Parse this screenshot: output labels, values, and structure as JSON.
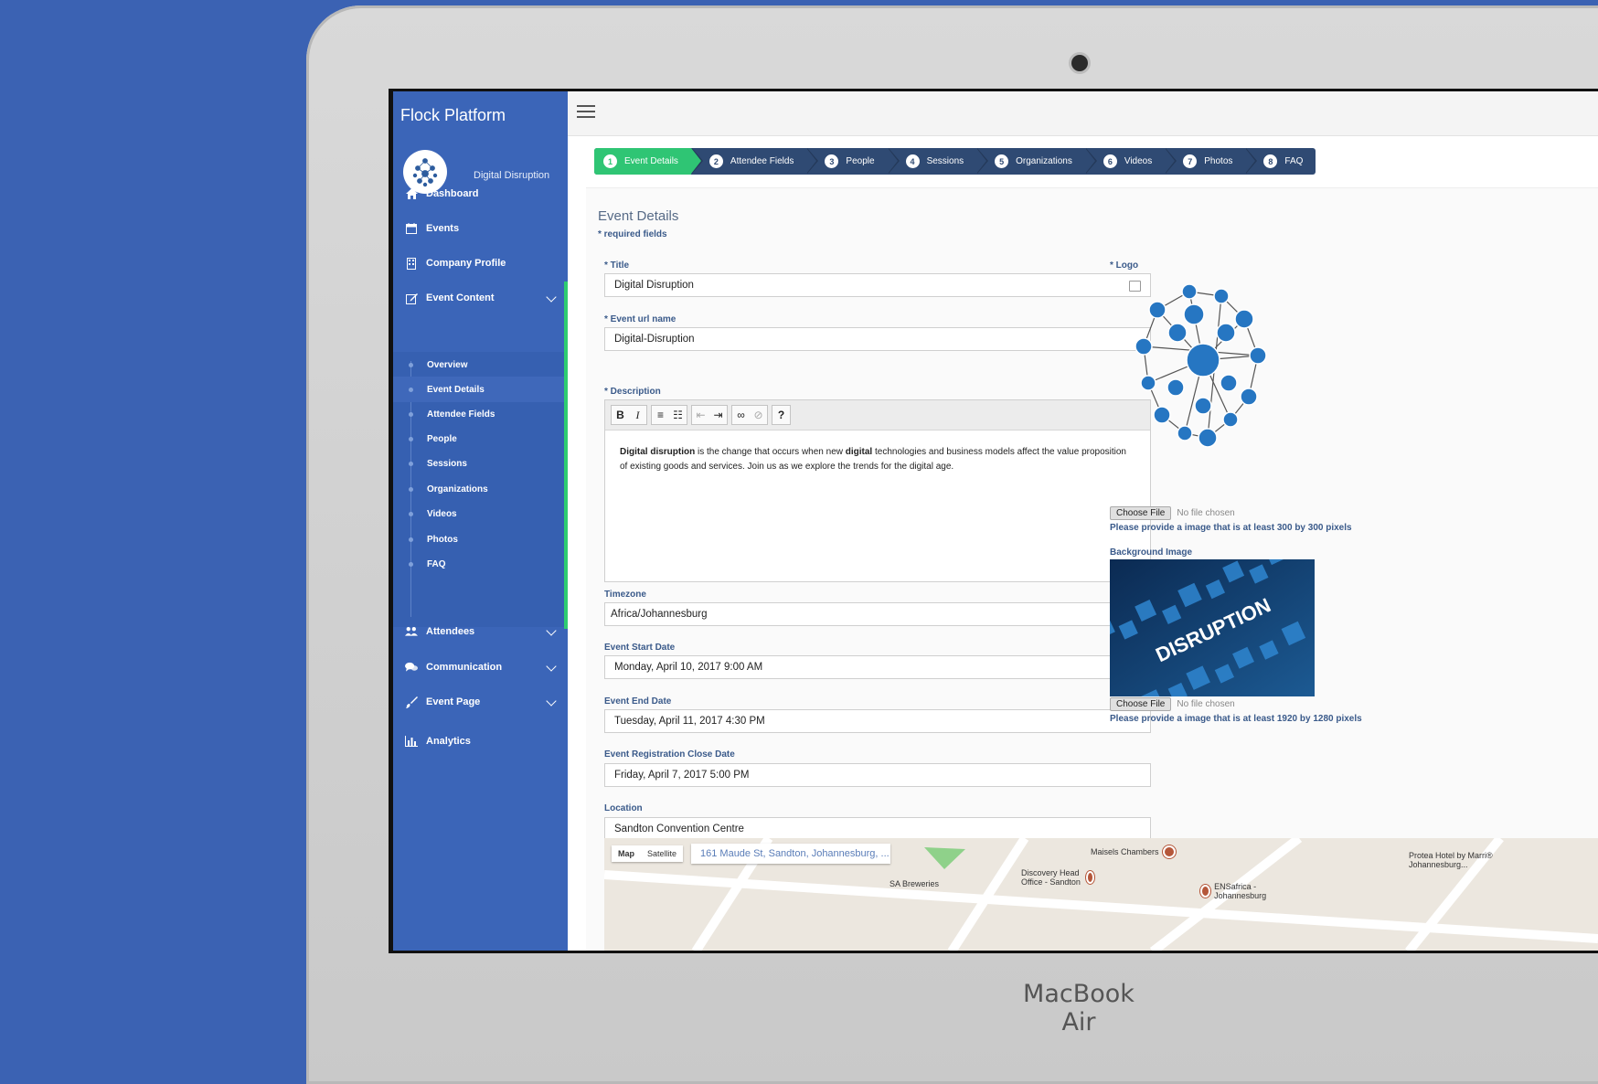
{
  "device_label": "MacBook Air",
  "app": {
    "title": "Flock Platform",
    "org_name": "Digital Disruption"
  },
  "nav": {
    "dashboard": "Dashboard",
    "events": "Events",
    "company_profile": "Company Profile",
    "event_content": "Event Content",
    "sub_items": [
      "Overview",
      "Event Details",
      "Attendee Fields",
      "People",
      "Sessions",
      "Organizations",
      "Videos",
      "Photos",
      "FAQ"
    ],
    "attendees": "Attendees",
    "communication": "Communication",
    "event_page": "Event Page",
    "analytics": "Analytics"
  },
  "wizard": {
    "steps": [
      {
        "num": "1",
        "label": "Event Details"
      },
      {
        "num": "2",
        "label": "Attendee Fields"
      },
      {
        "num": "3",
        "label": "People"
      },
      {
        "num": "4",
        "label": "Sessions"
      },
      {
        "num": "5",
        "label": "Organizations"
      },
      {
        "num": "6",
        "label": "Videos"
      },
      {
        "num": "7",
        "label": "Photos"
      },
      {
        "num": "8",
        "label": "FAQ"
      }
    ]
  },
  "form": {
    "section_title": "Event Details",
    "required_note": "* required fields",
    "title_label": "* Title",
    "title_value": "Digital Disruption",
    "url_label": "* Event url name",
    "url_value": "Digital-Disruption",
    "description_label": "* Description",
    "description_bold1": "Digital disruption",
    "description_part1": " is the change that occurs when new ",
    "description_bold2": "digital",
    "description_part2": " technologies and business models affect the value proposition of existing goods and services. Join us as we explore the trends for the digital age.",
    "timezone_label": "Timezone",
    "timezone_value": "Africa/Johannesburg",
    "start_label": "Event Start Date",
    "start_value": "Monday, April 10, 2017 9:00 AM",
    "end_label": "Event End Date",
    "end_value": "Tuesday, April 11, 2017 4:30 PM",
    "reg_close_label": "Event Registration Close Date",
    "reg_close_value": "Friday, April 7, 2017 5:00 PM",
    "location_label": "Location",
    "location_value": "Sandton Convention Centre",
    "logo_label": "* Logo",
    "choose_file": "Choose File",
    "no_file": "No file chosen",
    "logo_hint": "Please provide a image that is at least 300 by 300 pixels",
    "bg_label": "Background Image",
    "bg_hint": "Please provide a image that is at least 1920 by 1280 pixels",
    "bg_image_text": "DISRUPTION"
  },
  "map": {
    "tab_map": "Map",
    "tab_satellite": "Satellite",
    "search_value": "161 Maude St, Sandton, Johannesburg, ...",
    "pois": [
      "Maisels Chambers",
      "Discovery Head Office - Sandton",
      "SA Breweries",
      "ENSafrica - Johannesburg",
      "Protea Hotel by Marri® Johannesburg..."
    ]
  }
}
